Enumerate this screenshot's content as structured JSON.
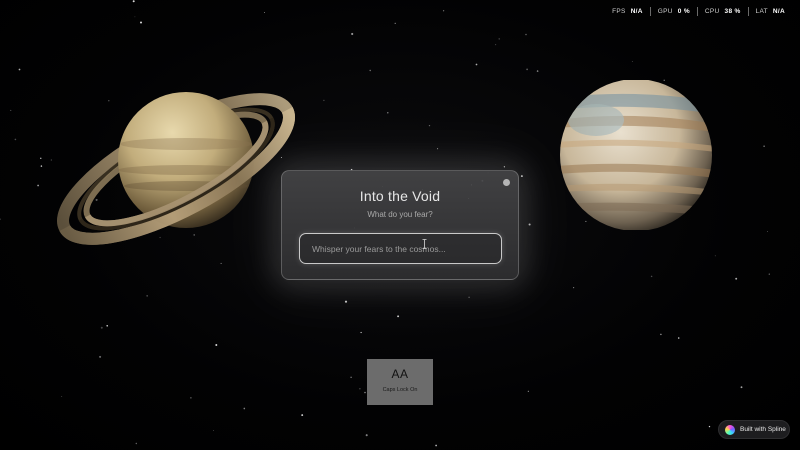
{
  "stats": [
    {
      "label": "FPS",
      "value": "N/A"
    },
    {
      "label": "GPU",
      "value": "0 %"
    },
    {
      "label": "CPU",
      "value": "38 %"
    },
    {
      "label": "LAT",
      "value": "N/A"
    }
  ],
  "card": {
    "title": "Into the Void",
    "subtitle": "What do you fear?",
    "input_placeholder": "Whisper your fears to the cosmos...",
    "input_value": ""
  },
  "caps_lock": {
    "glyph": "AA",
    "label": "Caps Lock On"
  },
  "badge": {
    "label": "Built with Spline",
    "icon": "spline-logo-icon"
  },
  "planets": [
    "saturn",
    "jupiter"
  ],
  "colors": {
    "background": "#000000",
    "card": "#3c3c3e",
    "caps_key": "#6c6c6c"
  }
}
